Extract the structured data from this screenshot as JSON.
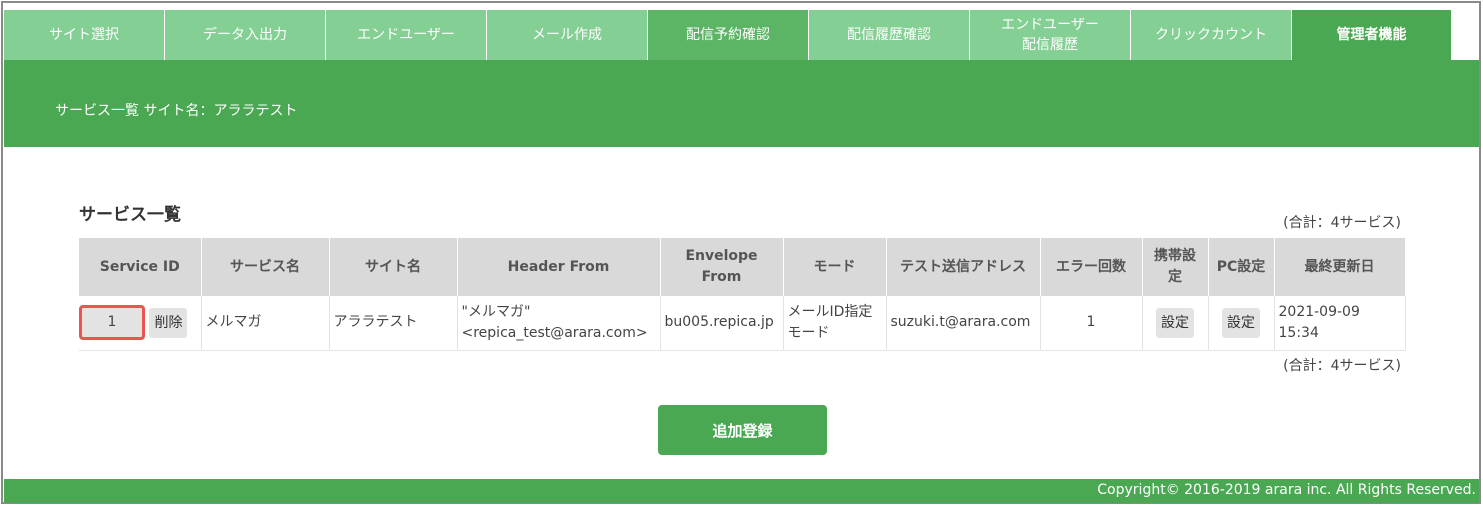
{
  "tabs": [
    {
      "label": "サイト選択"
    },
    {
      "label": "データ入出力"
    },
    {
      "label": "エンドユーザー"
    },
    {
      "label": "メール作成"
    },
    {
      "label": "配信予約確認"
    },
    {
      "label": "配信履歴確認"
    },
    {
      "label": "エンドユーザー\n配信履歴"
    },
    {
      "label": "クリックカウント"
    },
    {
      "label": "管理者機能"
    }
  ],
  "band": {
    "title": "サービス一覧 サイト名：アララテスト"
  },
  "section": {
    "title": "サービス一覧",
    "total_top": "(合計：4サービス)",
    "total_bottom": "(合計：4サービス)"
  },
  "table": {
    "headers": [
      "Service ID",
      "サービス名",
      "サイト名",
      "Header From",
      "Envelope\nFrom",
      "モード",
      "テスト送信アドレス",
      "エラー回数",
      "携帯設\n定",
      "PC設定",
      "最終更新日"
    ],
    "rows": [
      {
        "service_id": "1",
        "delete_label": "削除",
        "service_name": "メルマガ",
        "site_name": "アララテスト",
        "header_from": "\"メルマガ\"\n<repica_test@arara.com>",
        "envelope_from": "bu005.repica.jp",
        "mode": "メールID指定\nモード",
        "test_address": "suzuki.t@arara.com",
        "error_count": "1",
        "mobile_setting": "設定",
        "pc_setting": "設定",
        "updated": "2021-09-09\n15:34"
      }
    ]
  },
  "add_button": {
    "label": "追加登録"
  },
  "footer": {
    "copyright": "Copyright© 2016-2019 arara inc. All Rights Reserved."
  },
  "colors": {
    "primary_green": "#4aa853",
    "tab_green": "#84cf93",
    "highlight_red": "#ef5350"
  }
}
